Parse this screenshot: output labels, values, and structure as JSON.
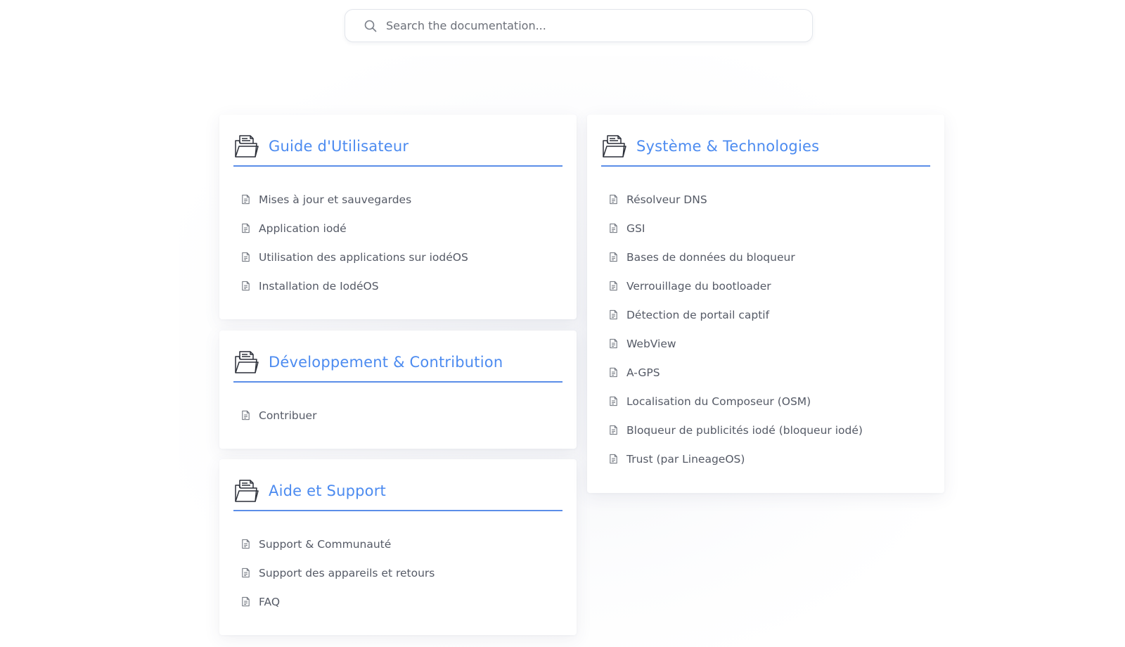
{
  "search": {
    "placeholder": "Search the documentation..."
  },
  "sections": {
    "guide": {
      "title": "Guide d'Utilisateur",
      "items": [
        "Mises à jour et sauvegardes",
        "Application iodé",
        "Utilisation des applications sur iodéOS",
        "Installation de IodéOS"
      ]
    },
    "dev": {
      "title": "Développement & Contribution",
      "items": [
        "Contribuer"
      ]
    },
    "support": {
      "title": "Aide et Support",
      "items": [
        "Support & Communauté",
        "Support des appareils et retours",
        "FAQ"
      ]
    },
    "system": {
      "title": "Système & Technologies",
      "items": [
        "Résolveur DNS",
        "GSI",
        "Bases de données du bloqueur",
        "Verrouillage du bootloader",
        "Détection de portail captif",
        "WebView",
        "A-GPS",
        "Localisation du Composeur (OSM)",
        "Bloqueur de publicités iodé (bloqueur iodé)",
        "Trust (par LineageOS)"
      ]
    }
  },
  "colors": {
    "accent": "#4c8bf0",
    "text": "#555a66",
    "divider": "#5b8ee8"
  },
  "icons": {
    "section": "folder-document-icon",
    "item": "document-icon",
    "search": "search-icon"
  }
}
